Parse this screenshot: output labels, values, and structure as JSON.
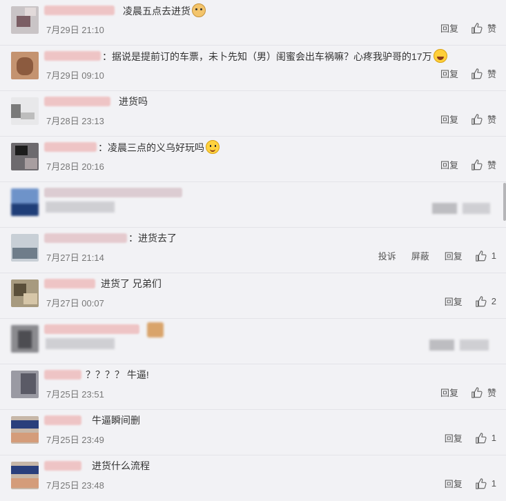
{
  "actions": {
    "reply": "回复",
    "like": "赞",
    "report": "投诉",
    "block": "屏蔽"
  },
  "comments": [
    {
      "text": "凌晨五点去进货",
      "time": "7月29日 21:10",
      "likes": "赞"
    },
    {
      "text": "：据说是提前订的车票，未卜先知（男）闺蜜会出车祸嘛？心疼我驴哥的17万",
      "time": "7月29日 09:10",
      "likes": "赞"
    },
    {
      "text": "进货吗",
      "time": "7月28日 23:13",
      "likes": "赞"
    },
    {
      "text": "：凌晨三点的义乌好玩吗",
      "time": "7月28日 20:16",
      "likes": "赞"
    },
    {
      "text": "",
      "time": "",
      "likes": ""
    },
    {
      "text": "：进货去了",
      "time": "7月27日 21:14",
      "likes": "1"
    },
    {
      "text": "进货了 兄弟们",
      "time": "7月27日 00:07",
      "likes": "2"
    },
    {
      "text": "",
      "time": "",
      "likes": ""
    },
    {
      "text": "？？？？ 牛逼!",
      "time": "7月25日 23:51",
      "likes": "赞"
    },
    {
      "text": "牛逼瞬间删",
      "time": "7月25日 23:49",
      "likes": "1"
    },
    {
      "text": "进货什么流程",
      "time": "7月25日 23:48",
      "likes": "1"
    }
  ]
}
